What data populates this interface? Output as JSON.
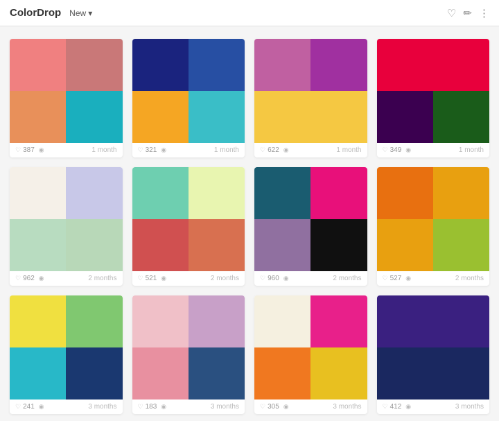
{
  "header": {
    "logo": "ColorDrop",
    "new_button": "New",
    "chevron": "▾",
    "icons": {
      "heart": "♡",
      "pencil": "✏",
      "more": "⋮"
    }
  },
  "palettes": [
    {
      "colors": [
        "#F08080",
        "#C97878",
        "#E8905A",
        "#1AAFBE"
      ],
      "likes": "387",
      "time": "1 month"
    },
    {
      "colors": [
        "#1A237E",
        "#274FA3",
        "#F5A623",
        "#3ABEC7"
      ],
      "likes": "321",
      "time": "1 month"
    },
    {
      "colors": [
        "#C060A1",
        "#A030A0",
        "#F5C842",
        "#F5C842"
      ],
      "likes": "622",
      "time": "1 month"
    },
    {
      "colors": [
        "#E8003C",
        "#E8003C",
        "#3B0050",
        "#1A5C1A"
      ],
      "likes": "349",
      "time": "1 month"
    },
    {
      "colors": [
        "#F5F0E8",
        "#C8C8E8",
        "#B8DCC0",
        "#B8D8B8"
      ],
      "likes": "962",
      "time": "2 months"
    },
    {
      "colors": [
        "#6ECFB0",
        "#E8F5B0",
        "#D05050",
        "#D87050"
      ],
      "likes": "521",
      "time": "2 months"
    },
    {
      "colors": [
        "#1A5C70",
        "#E8107A",
        "#9070A0",
        "#101010"
      ],
      "likes": "960",
      "time": "2 months"
    },
    {
      "colors": [
        "#E87010",
        "#E8A010",
        "#E8A010",
        "#9AC030"
      ],
      "likes": "527",
      "time": "2 months"
    },
    {
      "colors": [
        "#F0E040",
        "#80C870",
        "#28B8C8",
        "#1A3870"
      ],
      "likes": "241",
      "time": "3 months"
    },
    {
      "colors": [
        "#F0C0C8",
        "#C8A0C8",
        "#E890A0",
        "#2A5080"
      ],
      "likes": "183",
      "time": "3 months"
    },
    {
      "colors": [
        "#F5F0E0",
        "#E8208A",
        "#F07820",
        "#E8C020"
      ],
      "likes": "305",
      "time": "3 months"
    },
    {
      "colors": [
        "#3A2080",
        "#3A2080",
        "#1A2860",
        "#1A2860"
      ],
      "likes": "412",
      "time": "3 months"
    }
  ]
}
